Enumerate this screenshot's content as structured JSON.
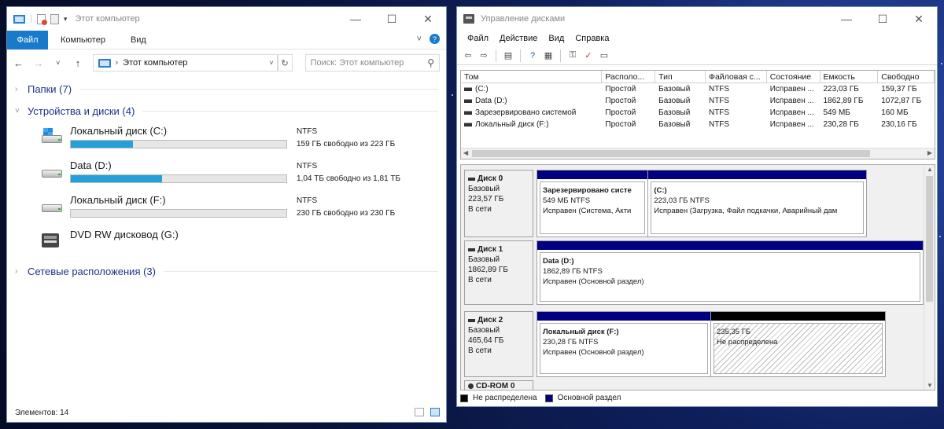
{
  "explorer": {
    "title": "Этот компьютер",
    "ribbon": {
      "file": "Файл",
      "tabs": [
        "Компьютер",
        "Вид"
      ]
    },
    "address": "Этот компьютер",
    "search_placeholder": "Поиск: Этот компьютер",
    "sections": {
      "folders": "Папки (7)",
      "devices": "Устройства и диски (4)",
      "network": "Сетевые расположения (3)"
    },
    "drives": [
      {
        "name": "Локальный диск (C:)",
        "fs": "NTFS",
        "free": "159 ГБ свободно из 223 ГБ",
        "used_fraction": 0.287
      },
      {
        "name": "Data (D:)",
        "fs": "NTFS",
        "free": "1,04 ТБ свободно из 1,81 ТБ",
        "used_fraction": 0.425
      },
      {
        "name": "Локальный диск (F:)",
        "fs": "NTFS",
        "free": "230 ГБ свободно из 230 ГБ",
        "used_fraction": 0.0
      },
      {
        "name": "DVD RW дисковод (G:)"
      }
    ],
    "status": "Элементов: 14"
  },
  "diskmgmt": {
    "title": "Управление дисками",
    "menu": [
      "Файл",
      "Действие",
      "Вид",
      "Справка"
    ],
    "columns": [
      "Том",
      "Располо...",
      "Тип",
      "Файловая с...",
      "Состояние",
      "Емкость",
      "Свободно"
    ],
    "volumes": [
      [
        "(C:)",
        "Простой",
        "Базовый",
        "NTFS",
        "Исправен ...",
        "223,03 ГБ",
        "159,37 ГБ"
      ],
      [
        "Data (D:)",
        "Простой",
        "Базовый",
        "NTFS",
        "Исправен ...",
        "1862,89 ГБ",
        "1072,87 ГБ"
      ],
      [
        "Зарезервировано системой",
        "Простой",
        "Базовый",
        "NTFS",
        "Исправен ...",
        "549 МБ",
        "160 МБ"
      ],
      [
        "Локальный диск (F:)",
        "Простой",
        "Базовый",
        "NTFS",
        "Исправен ...",
        "230,28 ГБ",
        "230,16 ГБ"
      ]
    ],
    "disks": [
      {
        "name": "Диск 0",
        "type": "Базовый",
        "size": "223,57 ГБ",
        "status": "В сети",
        "partitions": [
          {
            "name": "Зарезервировано систе",
            "size": "549 МБ NTFS",
            "state": "Исправен (Система, Акти"
          },
          {
            "name": "(C:)",
            "size": "223,03 ГБ NTFS",
            "state": "Исправен (Загрузка, Файл подкачки, Аварийный дам"
          }
        ]
      },
      {
        "name": "Диск 1",
        "type": "Базовый",
        "size": "1862,89 ГБ",
        "status": "В сети",
        "partitions": [
          {
            "name": "Data  (D:)",
            "size": "1862,89 ГБ NTFS",
            "state": "Исправен (Основной раздел)"
          }
        ]
      },
      {
        "name": "Диск 2",
        "type": "Базовый",
        "size": "465,64 ГБ",
        "status": "В сети",
        "partitions": [
          {
            "name": "Локальный диск  (F:)",
            "size": "230,28 ГБ NTFS",
            "state": "Исправен (Основной раздел)"
          },
          {
            "name": "",
            "size": "235,35 ГБ",
            "state": "Не распределена"
          }
        ]
      }
    ],
    "cdrom": "CD-ROM 0",
    "legend": {
      "unallocated": "Не распределена",
      "primary": "Основной раздел"
    },
    "colors": {
      "primary": "#000080",
      "unallocated": "#000000",
      "accent": "#1979ca",
      "bar": "#26a0da"
    }
  }
}
